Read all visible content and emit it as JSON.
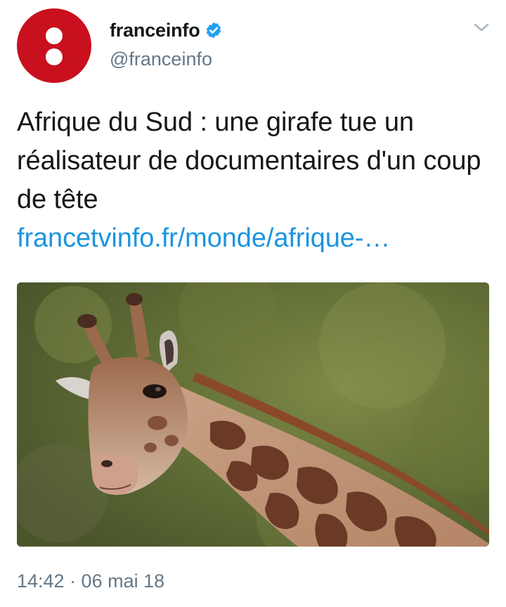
{
  "author": {
    "display_name": "franceinfo",
    "handle": "@franceinfo",
    "verified": true,
    "avatar_color": "#c8101e"
  },
  "tweet": {
    "text": "Afrique du Sud : une girafe tue un réalisateur de documentaires d'un coup de tête",
    "link": "francetvinfo.fr/monde/afrique-…",
    "media_subject": "giraffe-photo",
    "timestamp": "14:42 · 06 mai 18"
  },
  "colors": {
    "text": "#14171a",
    "secondary": "#657786",
    "link": "#1b95e0",
    "verified": "#1da1f2"
  },
  "icons": {
    "menu": "chevron-down-icon",
    "verified": "verified-badge-icon"
  }
}
